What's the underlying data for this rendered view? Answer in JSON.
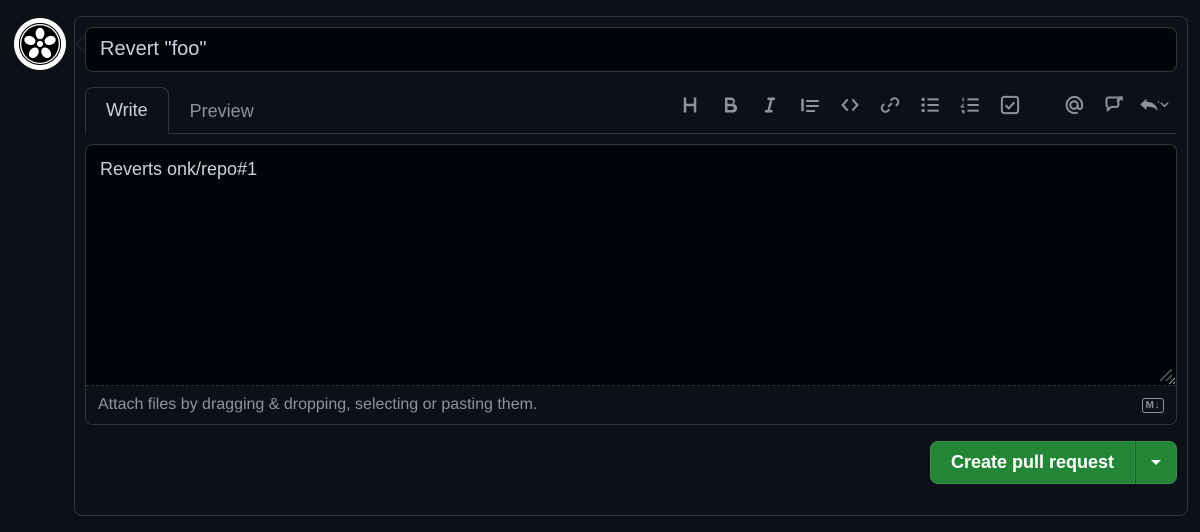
{
  "title_value": "Revert \"foo\"",
  "tabs": {
    "write": "Write",
    "preview": "Preview"
  },
  "body_value": "Reverts onk/repo#1",
  "attach_hint": "Attach files by dragging & dropping, selecting or pasting them.",
  "markdown_badge": "M↓",
  "submit": {
    "label": "Create pull request"
  },
  "toolbar_icons": {
    "heading": "heading-icon",
    "bold": "bold-icon",
    "italic": "italic-icon",
    "quote": "quote-icon",
    "code": "code-icon",
    "link": "link-icon",
    "ul": "bulleted-list-icon",
    "ol": "numbered-list-icon",
    "task": "task-list-icon",
    "mention": "mention-icon",
    "crossref": "cross-reference-icon",
    "reply": "saved-reply-icon"
  }
}
